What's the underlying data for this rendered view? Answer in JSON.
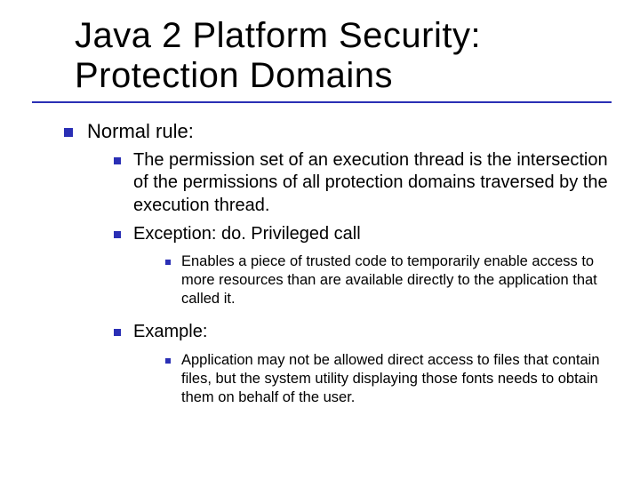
{
  "title_line1": "Java 2 Platform Security:",
  "title_line2": "Protection Domains",
  "lvl1_1": "Normal rule:",
  "lvl2_1": "The permission set of an execution thread is the intersection of the permissions of all protection domains traversed by the execution thread.",
  "lvl2_2": "Exception: do. Privileged call",
  "lvl3_1": "Enables a piece of trusted code to temporarily enable access to more resources than are available directly to the application that called it.",
  "lvl2_3": "Example:",
  "lvl3_2": "Application may not be allowed direct access to files that contain files, but the system utility displaying those fonts needs to obtain them on behalf of the user."
}
